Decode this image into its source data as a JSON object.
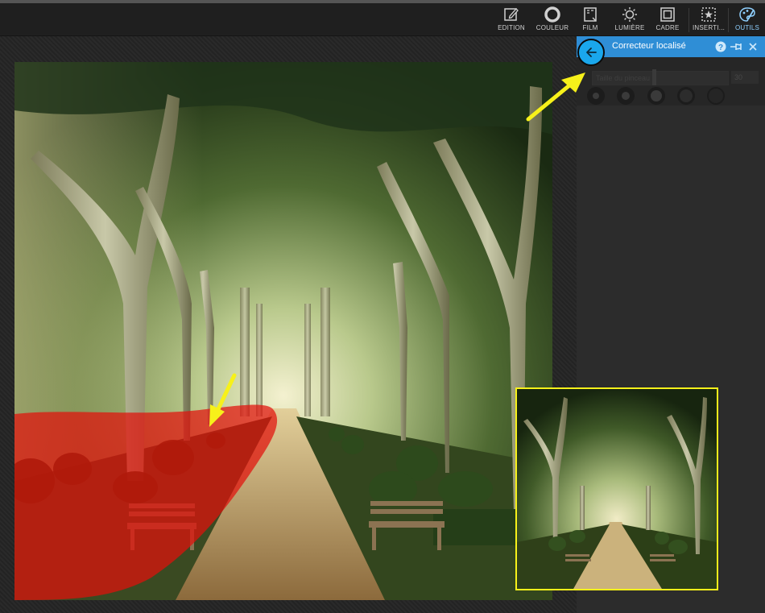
{
  "toolbar": {
    "items": [
      {
        "label": "EDITION",
        "icon": "edit-icon"
      },
      {
        "label": "COULEUR",
        "icon": "color-circle-icon"
      },
      {
        "label": "FILM",
        "icon": "film-icon"
      },
      {
        "label": "LUMIÈRE",
        "icon": "sun-icon"
      },
      {
        "label": "CADRE",
        "icon": "frame-icon"
      },
      {
        "label": "INSERTI...",
        "icon": "insert-star-icon"
      },
      {
        "label": "OUTILS",
        "icon": "tools-palette-icon"
      }
    ],
    "active": "OUTILS",
    "active_color": "#8fd0ff"
  },
  "panel": {
    "title": "Correcteur localisé",
    "header_color": "#2f8ed6",
    "back_button_color": "#1aa7ec",
    "help_icon": "help-icon",
    "pin_icon": "pin-icon",
    "close_icon": "close-icon",
    "brush_size_label": "Taille du pinceau",
    "brush_size_value": "30"
  },
  "annotations": {
    "arrow_color": "#f7f11a",
    "overlay_color": "#e2100b",
    "inset_border_color": "#f7f11a"
  }
}
